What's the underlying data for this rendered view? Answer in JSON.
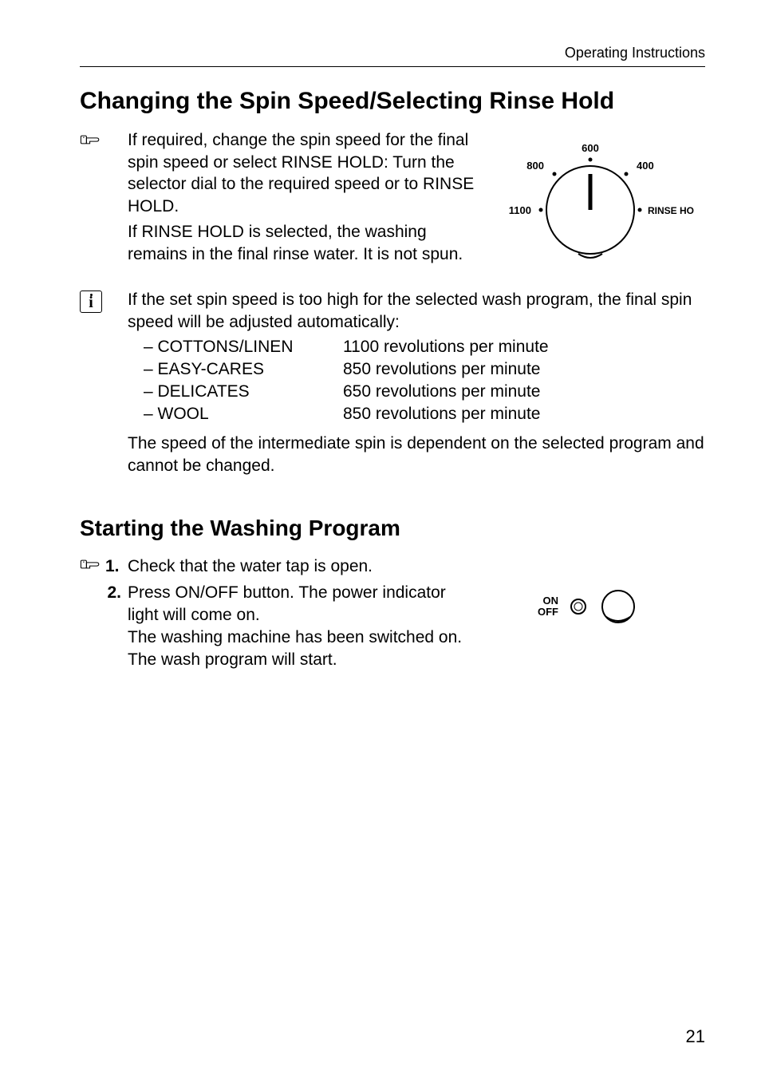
{
  "header": {
    "running": "Operating Instructions"
  },
  "section1": {
    "title": "Changing the Spin Speed/Selecting Rinse Hold",
    "para1": "If required, change the spin speed for the final spin speed or select RINSE HOLD: Turn the selector dial to the required speed or to RINSE HOLD.",
    "para2": "If RINSE HOLD is selected, the washing remains in the final rinse water. It is not spun.",
    "note_intro": "If the set spin speed is too high for the selected wash program, the final spin speed will be adjusted automatically:",
    "items": [
      {
        "label": "– COTTONS/LINEN",
        "value": "1100 revolutions per minute"
      },
      {
        "label": "– EASY-CARES",
        "value": "850 revolutions per minute"
      },
      {
        "label": "– DELICATES",
        "value": "650 revolutions per minute"
      },
      {
        "label": "– WOOL",
        "value": "850 revolutions per minute"
      }
    ],
    "footnote": "The speed of the intermediate spin is dependent on the selected program and cannot be changed."
  },
  "dial": {
    "t600": "600",
    "t800": "800",
    "t400": "400",
    "t1100": "1100",
    "trh": "RINSE HOLD"
  },
  "section2": {
    "title": "Starting the Washing Program",
    "step1": "Check that the water tap is open.",
    "step2a": "Press ON/OFF button. The power indicator light will come on.",
    "step2b": "The washing machine has been switched on. The wash program will start."
  },
  "onoff": {
    "label_on": "ON",
    "label_off": "OFF"
  },
  "pageNumber": "21"
}
